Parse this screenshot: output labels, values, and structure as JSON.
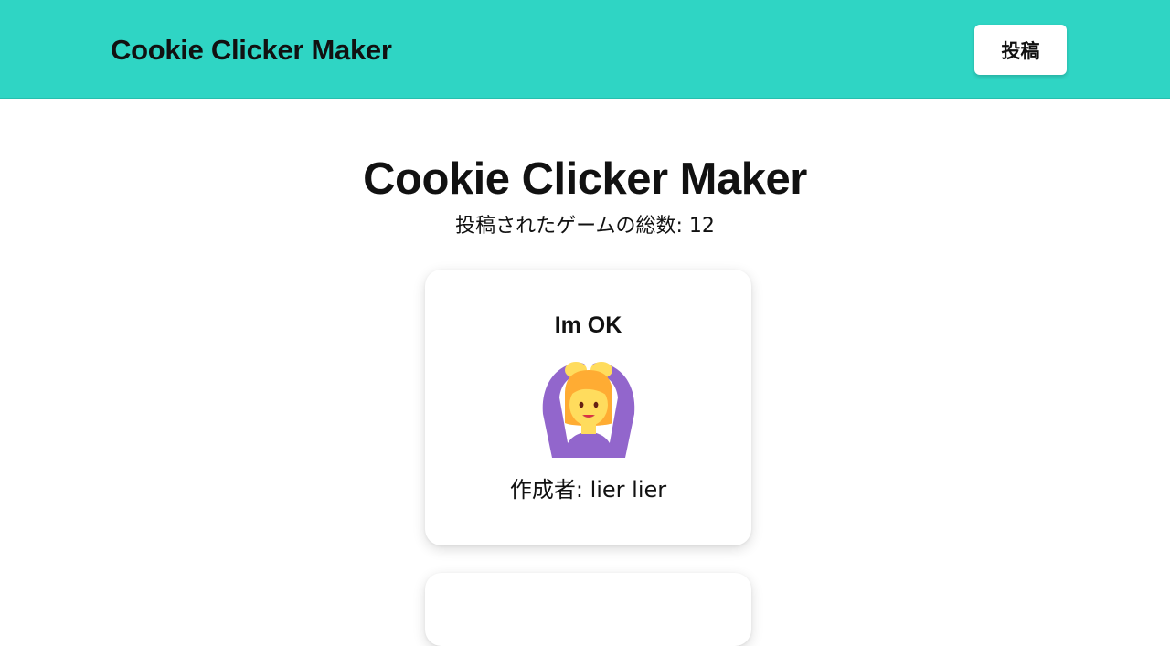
{
  "header": {
    "brand": "Cookie Clicker Maker",
    "post_label": "投稿"
  },
  "main": {
    "title": "Cookie Clicker Maker",
    "total_label": "投稿されたゲームの総数: 12"
  },
  "games": [
    {
      "title": "Im OK",
      "icon": "person-gesturing-ok-emoji",
      "author_label": "作成者: lier lier"
    }
  ],
  "colors": {
    "header_bg": "#2fd5c4",
    "card_bg": "#ffffff",
    "text": "#111111",
    "emoji_purple": "#9266cc",
    "emoji_skin": "#ffdc5d",
    "emoji_hair": "#ffac33"
  }
}
